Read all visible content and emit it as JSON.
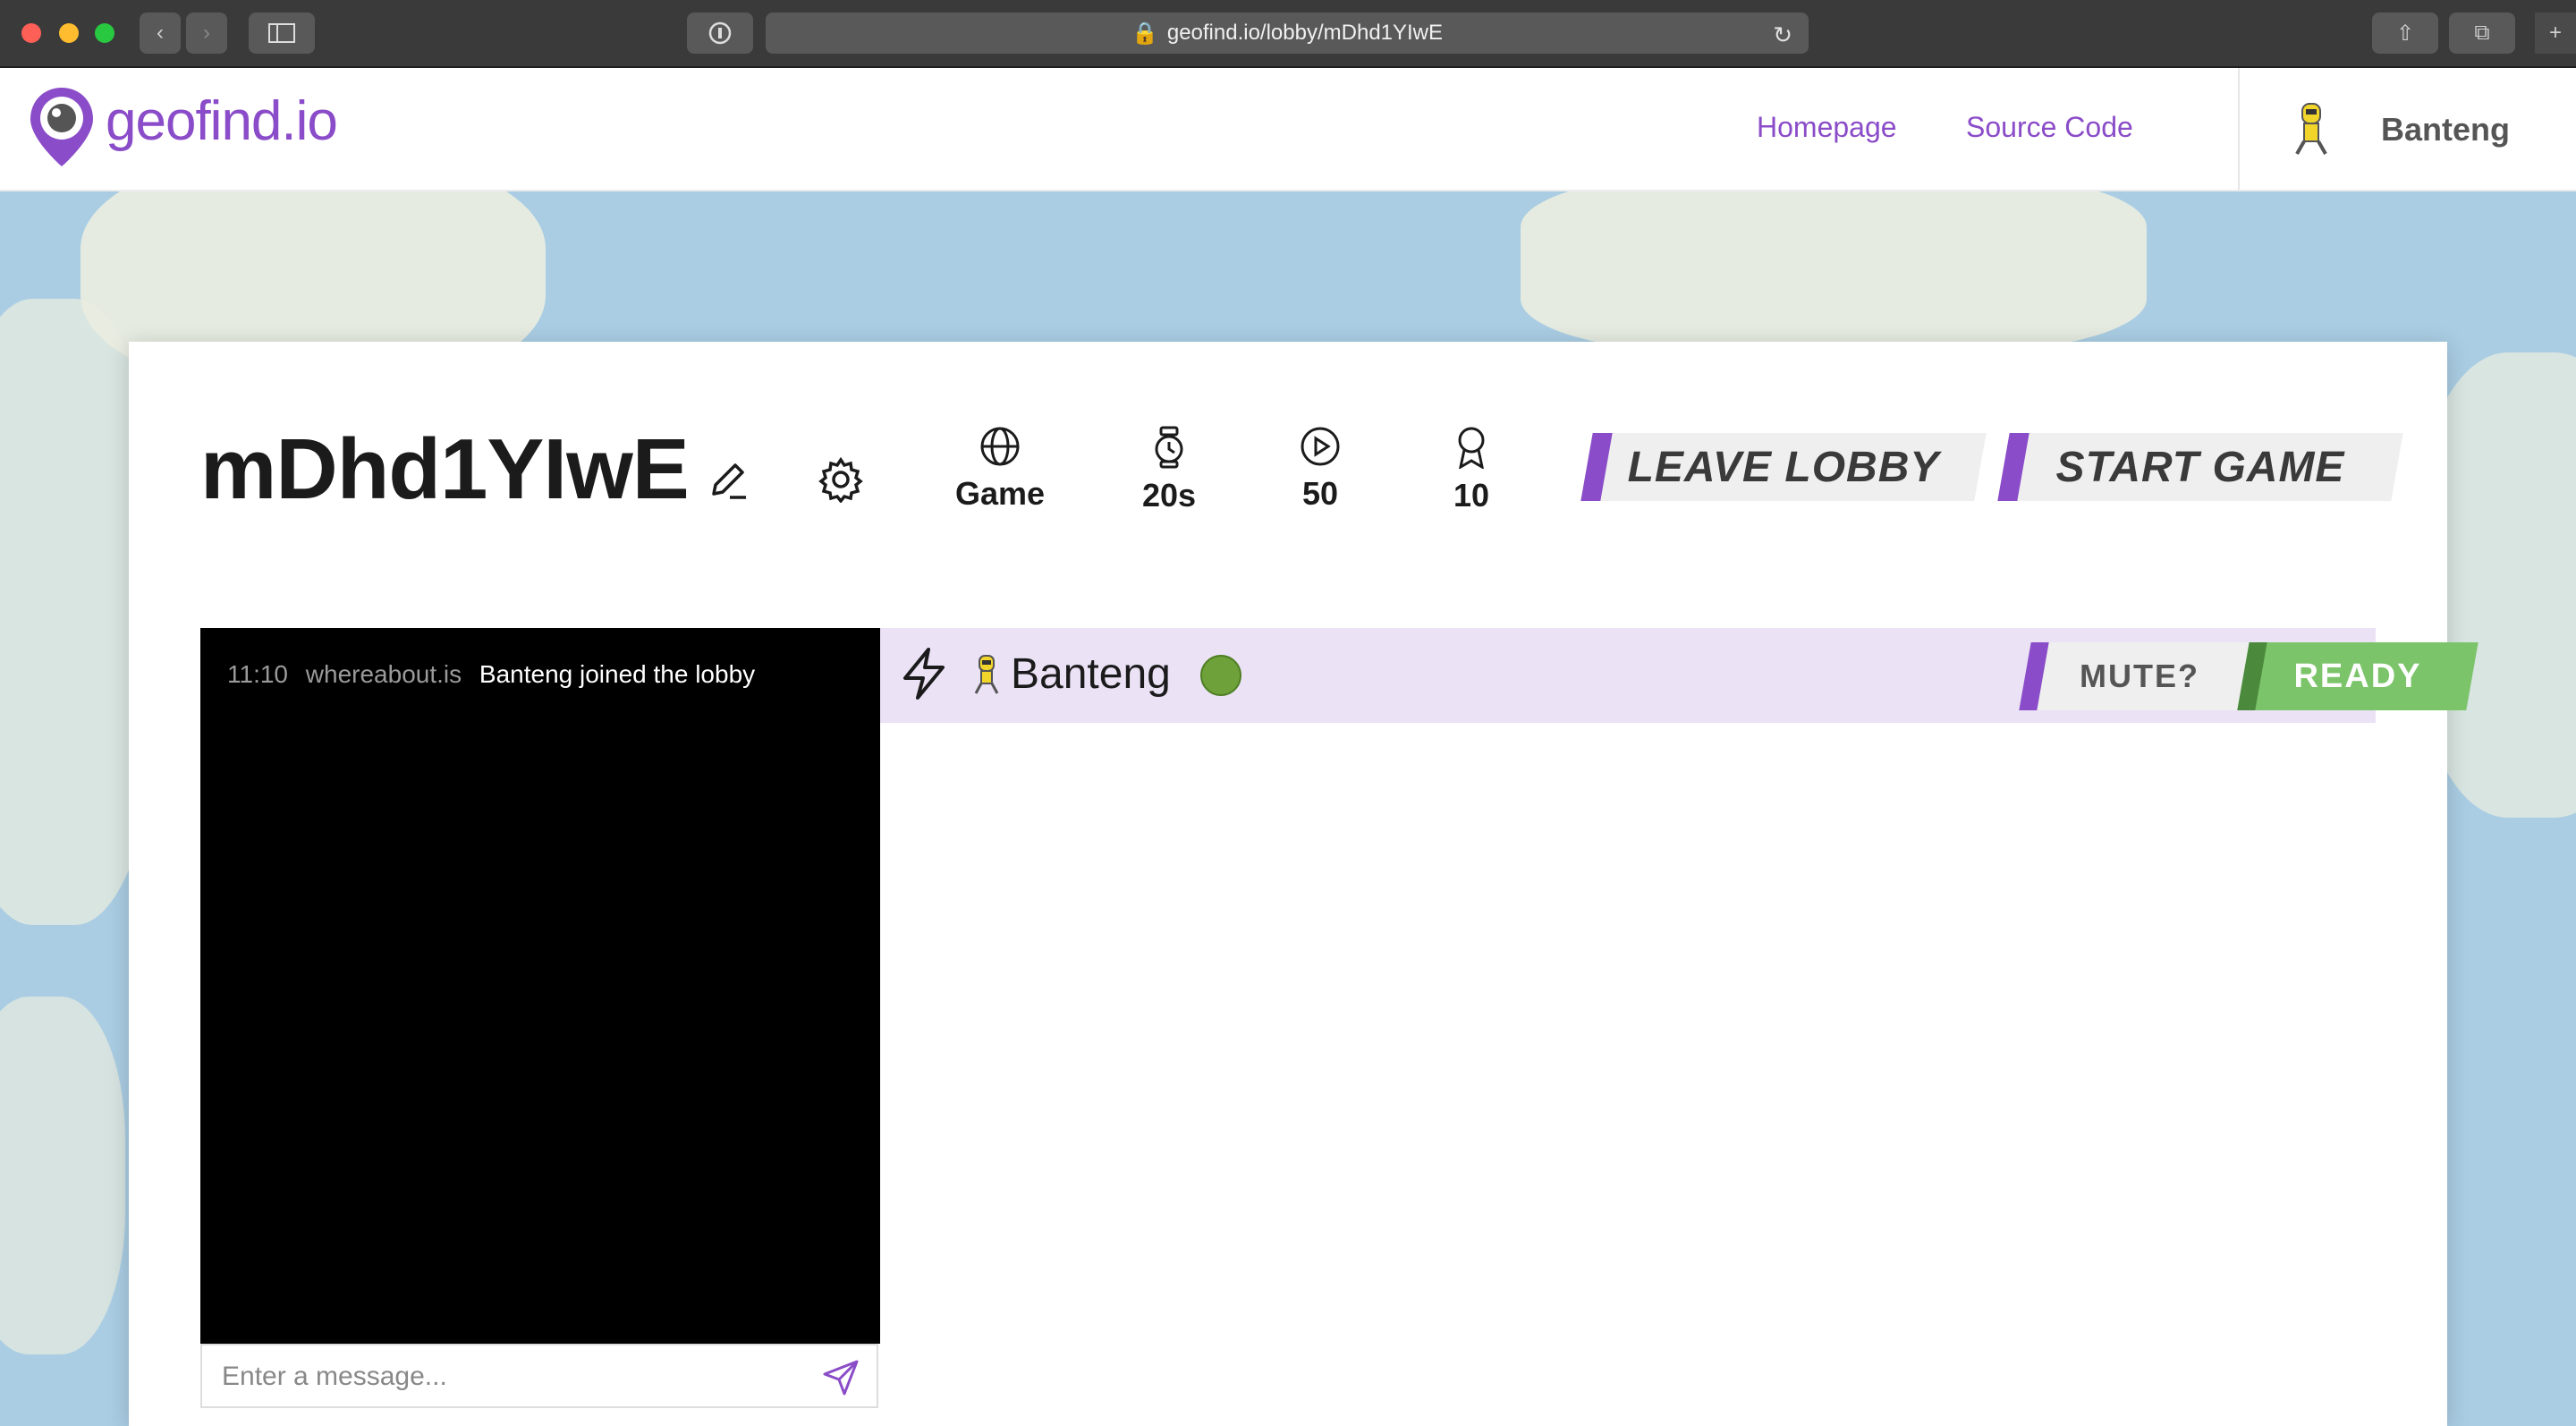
{
  "browser": {
    "url": "geofind.io/lobby/mDhd1YIwE"
  },
  "header": {
    "logo_text": "geofind.io",
    "nav": [
      {
        "label": "Homepage"
      },
      {
        "label": "Source Code"
      }
    ],
    "user": {
      "name": "Banteng"
    }
  },
  "lobby": {
    "code": "mDhd1YIwE",
    "settings": [
      {
        "icon": "globe-icon",
        "value": "Game"
      },
      {
        "icon": "stopwatch-icon",
        "value": "20s"
      },
      {
        "icon": "play-circle-icon",
        "value": "50"
      },
      {
        "icon": "award-icon",
        "value": "10"
      }
    ],
    "leave_label": "LEAVE LOBBY",
    "start_label": "START GAME"
  },
  "chat": {
    "messages": [
      {
        "time": "11:10",
        "sender": "whereabout.is",
        "text": "Banteng joined the lobby"
      }
    ],
    "placeholder": "Enter a message..."
  },
  "players": [
    {
      "name": "Banteng",
      "status_color": "#6fa13a",
      "mute_label": "MUTE?",
      "ready_label": "READY"
    }
  ],
  "colors": {
    "brand": "#8a4cc8",
    "ready": "#7cc46a",
    "player_row": "#ebe2f6"
  }
}
